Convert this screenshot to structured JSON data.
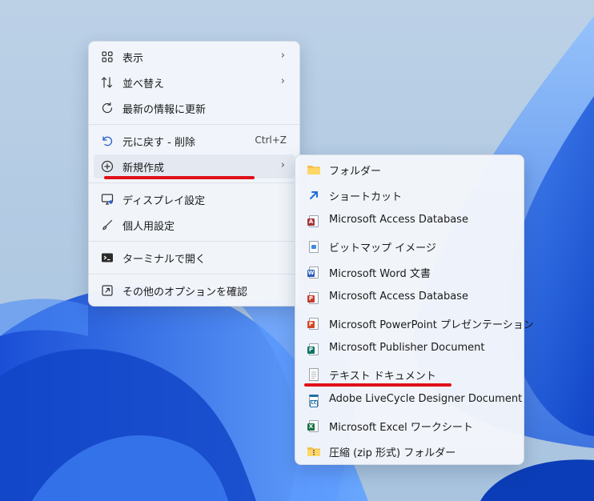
{
  "context_menu": {
    "items": [
      {
        "label": "表示",
        "icon": "view-grid-icon",
        "arrow": "›"
      },
      {
        "label": "並べ替え",
        "icon": "sort-icon",
        "arrow": "›"
      },
      {
        "label": "最新の情報に更新",
        "icon": "refresh-icon"
      },
      {
        "label": "元に戻す - 削除",
        "icon": "undo-icon",
        "shortcut": "Ctrl+Z"
      },
      {
        "label": "新規作成",
        "icon": "new-plus-icon",
        "arrow": "›"
      },
      {
        "label": "ディスプレイ設定",
        "icon": "display-settings-icon"
      },
      {
        "label": "個人用設定",
        "icon": "brush-icon"
      },
      {
        "label": "ターミナルで開く",
        "icon": "terminal-icon"
      },
      {
        "label": "その他のオプションを確認",
        "icon": "more-options-icon"
      }
    ]
  },
  "submenu": {
    "items": [
      {
        "label": "フォルダー",
        "icon": "folder-icon"
      },
      {
        "label": "ショートカット",
        "icon": "shortcut-arrow-icon"
      },
      {
        "label": "Microsoft Access Database",
        "icon": "access-icon"
      },
      {
        "label": "ビットマップ イメージ",
        "icon": "bitmap-icon"
      },
      {
        "label": "Microsoft Word 文書",
        "icon": "word-icon"
      },
      {
        "label": "Microsoft Access Database",
        "icon": "access-pdf-icon"
      },
      {
        "label": "Microsoft PowerPoint プレゼンテーション",
        "icon": "powerpoint-icon"
      },
      {
        "label": "Microsoft Publisher Document",
        "icon": "publisher-icon"
      },
      {
        "label": "テキスト ドキュメント",
        "icon": "text-document-icon"
      },
      {
        "label": "Adobe LiveCycle Designer Document",
        "icon": "livecycle-icon"
      },
      {
        "label": "Microsoft Excel ワークシート",
        "icon": "excel-icon"
      },
      {
        "label": "圧縮 (zip 形式) フォルダー",
        "icon": "zip-folder-icon"
      }
    ]
  },
  "colors": {
    "highlight_underline": "#e0101a",
    "menu_background": "#f3f6fb",
    "hover_background": "#e4e9f1"
  }
}
